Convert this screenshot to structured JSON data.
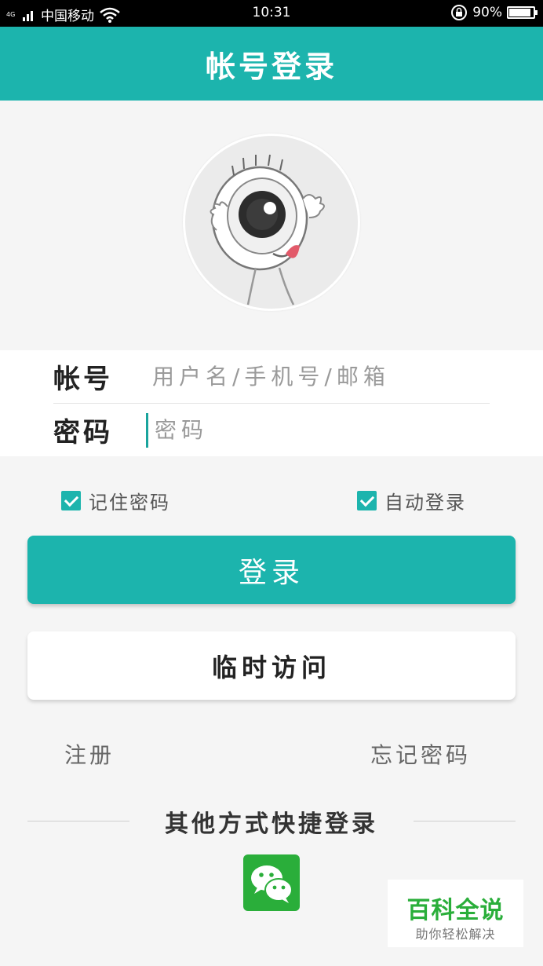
{
  "status_bar": {
    "network_type": "4G",
    "carrier": "中国移动",
    "time": "10:31",
    "battery_percent": "90%",
    "battery_level": 0.9
  },
  "app_bar": {
    "title": "帐号登录"
  },
  "form": {
    "account_label": "帐号",
    "account_placeholder": "用户名/手机号/邮箱",
    "password_label": "密码",
    "password_placeholder": "密码"
  },
  "options": {
    "remember_password": {
      "label": "记住密码",
      "checked": true
    },
    "auto_login": {
      "label": "自动登录",
      "checked": true
    }
  },
  "buttons": {
    "login": "登录",
    "guest": "临时访问"
  },
  "links": {
    "register": "注册",
    "forgot_password": "忘记密码"
  },
  "other_login": {
    "title": "其他方式快捷登录",
    "providers": [
      "wechat-icon"
    ]
  },
  "watermark": {
    "title": "百科全说",
    "subtitle": "助你轻松解决"
  },
  "colors": {
    "accent": "#1cb4ad",
    "wechat": "#2aae3a"
  }
}
